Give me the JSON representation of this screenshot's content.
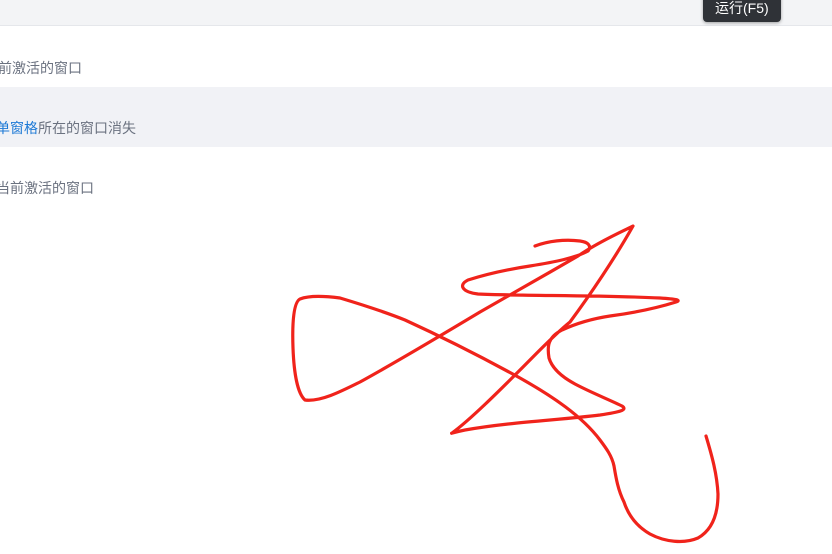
{
  "tooltip": {
    "label": "运行(F5)"
  },
  "rows": [
    {
      "text": "前激活的窗口"
    },
    {
      "link": "单窗格",
      "text": "所在的窗口消失"
    },
    {
      "text": "当前激活的窗口"
    }
  ],
  "annotation": {
    "color": "#f0231b"
  }
}
